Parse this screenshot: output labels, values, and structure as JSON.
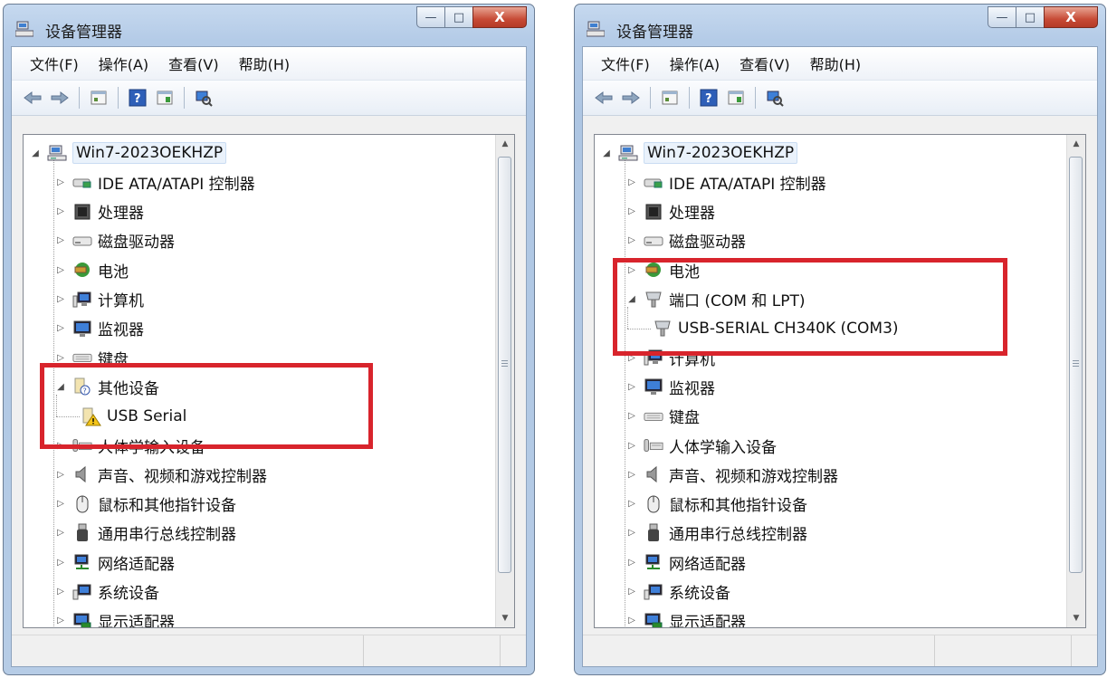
{
  "title": "设备管理器",
  "menu": [
    "文件(F)",
    "操作(A)",
    "查看(V)",
    "帮助(H)"
  ],
  "window_buttons": {
    "minimize": "—",
    "maximize": "□",
    "close": "X"
  },
  "toolbar_icons": [
    "back-arrow-icon",
    "forward-arrow-icon",
    "properties-icon",
    "help-icon",
    "update-driver-icon",
    "scan-hardware-icon"
  ],
  "accent_color": "#d8242c",
  "left": {
    "root": "Win7-2023OEKHZP",
    "items": [
      {
        "label": "IDE ATA/ATAPI 控制器",
        "icon": "ide-controller-icon"
      },
      {
        "label": "处理器",
        "icon": "processor-icon"
      },
      {
        "label": "磁盘驱动器",
        "icon": "disk-drive-icon"
      },
      {
        "label": "电池",
        "icon": "battery-icon"
      },
      {
        "label": "计算机",
        "icon": "computer-icon"
      },
      {
        "label": "监视器",
        "icon": "monitor-icon"
      },
      {
        "label": "键盘",
        "icon": "keyboard-icon"
      },
      {
        "label": "其他设备",
        "icon": "other-devices-icon"
      },
      {
        "label": "USB Serial",
        "icon": "warning-device-icon"
      },
      {
        "label": "人体学输入设备",
        "icon": "hid-icon"
      },
      {
        "label": "声音、视频和游戏控制器",
        "icon": "sound-icon"
      },
      {
        "label": "鼠标和其他指针设备",
        "icon": "mouse-icon"
      },
      {
        "label": "通用串行总线控制器",
        "icon": "usb-controller-icon"
      },
      {
        "label": "网络适配器",
        "icon": "network-adapter-icon"
      },
      {
        "label": "系统设备",
        "icon": "system-devices-icon"
      },
      {
        "label": "显示适配器",
        "icon": "display-adapter-icon"
      }
    ]
  },
  "right": {
    "root": "Win7-2023OEKHZP",
    "items": [
      {
        "label": "IDE ATA/ATAPI 控制器",
        "icon": "ide-controller-icon"
      },
      {
        "label": "处理器",
        "icon": "processor-icon"
      },
      {
        "label": "磁盘驱动器",
        "icon": "disk-drive-icon"
      },
      {
        "label": "电池",
        "icon": "battery-icon"
      },
      {
        "label": "端口 (COM 和 LPT)",
        "icon": "port-icon"
      },
      {
        "label": "USB-SERIAL CH340K (COM3)",
        "icon": "port-icon"
      },
      {
        "label": "计算机",
        "icon": "computer-icon"
      },
      {
        "label": "监视器",
        "icon": "monitor-icon"
      },
      {
        "label": "键盘",
        "icon": "keyboard-icon"
      },
      {
        "label": "人体学输入设备",
        "icon": "hid-icon"
      },
      {
        "label": "声音、视频和游戏控制器",
        "icon": "sound-icon"
      },
      {
        "label": "鼠标和其他指针设备",
        "icon": "mouse-icon"
      },
      {
        "label": "通用串行总线控制器",
        "icon": "usb-controller-icon"
      },
      {
        "label": "网络适配器",
        "icon": "network-adapter-icon"
      },
      {
        "label": "系统设备",
        "icon": "system-devices-icon"
      },
      {
        "label": "显示适配器",
        "icon": "display-adapter-icon"
      }
    ]
  }
}
